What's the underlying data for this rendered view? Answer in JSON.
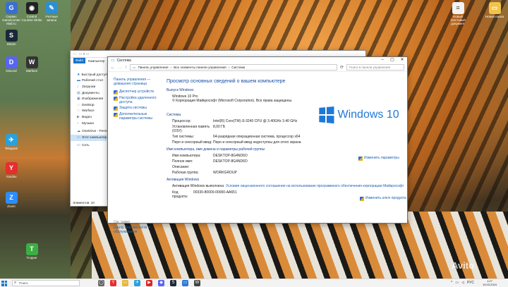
{
  "desktop": {
    "icons": [
      {
        "label": "Сервис GameCenter Mail.ru",
        "glyph": "G",
        "color": "#3a6fd0"
      },
      {
        "label": "Control Counter-Strike",
        "glyph": "◉",
        "color": "#222"
      },
      {
        "label": "Учетные записи",
        "glyph": "✎",
        "color": "#2c8fd6"
      },
      {
        "label": "Новый текстовый документ",
        "glyph": "≡",
        "color": "#f2f2f2"
      },
      {
        "label": "Новая папка",
        "glyph": "▭",
        "color": "#f1c34a"
      },
      {
        "label": "Steam",
        "glyph": "S",
        "color": "#1b2838"
      },
      {
        "label": "Discord",
        "glyph": "D",
        "color": "#5865f2"
      },
      {
        "label": "Warface",
        "glyph": "W",
        "color": "#333"
      },
      {
        "label": "Telegram",
        "glyph": "✈",
        "color": "#2aa1da"
      },
      {
        "label": "Yandex",
        "glyph": "Y",
        "color": "#e62e2e"
      },
      {
        "label": "Zoom",
        "glyph": "Z",
        "color": "#2d8cff"
      },
      {
        "label": "Tropper",
        "glyph": "T",
        "color": "#3cae45"
      }
    ],
    "watermark": "Avito"
  },
  "explorer": {
    "ribbon": [
      "Файл",
      "Компьютер",
      "Вид"
    ],
    "nav": [
      {
        "label": "Быстрый доступ",
        "icon": "★",
        "color": "#1e78d7"
      },
      {
        "label": "Рабочий стол",
        "icon": "▬",
        "color": "#2b7bd4"
      },
      {
        "label": "Загрузки",
        "icon": "↓",
        "color": "#2b7bd4"
      },
      {
        "label": "Документы",
        "icon": "▤",
        "color": "#6c8bb3"
      },
      {
        "label": "Изображения",
        "icon": "▣",
        "color": "#6c8bb3"
      },
      {
        "label": "Desktop",
        "icon": "▭",
        "color": "#e8b73a"
      },
      {
        "label": "Warface",
        "icon": "▭",
        "color": "#e8b73a"
      },
      {
        "label": "Видео",
        "icon": "▶",
        "color": "#6c8bb3"
      },
      {
        "label": "Музыка",
        "icon": "♪",
        "color": "#6c8bb3"
      },
      {
        "label": "OneDrive - Personal",
        "icon": "☁",
        "color": "#1e78d7"
      },
      {
        "label": "Этот компьютер",
        "icon": "▭",
        "color": "#2b7bd4"
      },
      {
        "label": "Сеть",
        "icon": "▭",
        "color": "#2b7bd4"
      }
    ],
    "status": "Элементов: 10"
  },
  "system": {
    "title": "Система",
    "breadcrumb": [
      "Панель управления",
      "Все элементы панели управления",
      "Система"
    ],
    "search_placeholder": "Поиск в панели управления",
    "left": {
      "home": "Панель управления — домашняя страница",
      "links": [
        "Диспетчер устройств",
        "Настройка удаленного доступа",
        "Защита системы",
        "Дополнительные параметры системы"
      ],
      "see_also": "См. также",
      "bottom": "Центр безопасности и обслуживания"
    },
    "heading": "Просмотр основных сведений о вашем компьютере",
    "edition_title": "Выпуск Windows",
    "edition": "Windows 10 Pro",
    "copyright": "© Корпорация Майкрософт (Microsoft Corporation). Все права защищены.",
    "logo_text": "Windows 10",
    "system_title": "Система",
    "system_rows": [
      {
        "k": "Процессор:",
        "v": "Intel(R) Core(TM) i3-3240 CPU @ 3.40GHz   3.40 GHz"
      },
      {
        "k": "Установленная память (ОЗУ):",
        "v": "8,00 ГБ"
      },
      {
        "k": "Тип системы:",
        "v": "64-разрядная операционная система, процессор x64"
      },
      {
        "k": "Перо и сенсорный ввод:",
        "v": "Перо и сенсорный ввод недоступны для этого экрана"
      }
    ],
    "name_title": "Имя компьютера, имя домена и параметры рабочей группы",
    "name_rows": [
      {
        "k": "Имя компьютера:",
        "v": "DESKTOP-8G4ND6O"
      },
      {
        "k": "Полное имя:",
        "v": "DESKTOP-8G4ND6O"
      },
      {
        "k": "Описание:",
        "v": ""
      },
      {
        "k": "Рабочая группа:",
        "v": "WORKGROUP"
      }
    ],
    "change_params": "Изменить параметры",
    "activation_title": "Активация Windows",
    "activation_status": "Активация Windows выполнена",
    "activation_link": "Условия лицензионного соглашения на использование программного обеспечения корпорации Майкрософт",
    "product_code_label": "Код продукта:",
    "product_code": "00330-80000-00000-AA651",
    "change_key": "Изменить ключ продукта"
  },
  "taskbar": {
    "search_placeholder": "Поиск",
    "apps": [
      {
        "glyph": "◯",
        "color": "#666"
      },
      {
        "glyph": "Y",
        "color": "#e62e2e"
      },
      {
        "glyph": "▭",
        "color": "#e8b73a"
      },
      {
        "glyph": "✈",
        "color": "#2aa1da"
      },
      {
        "glyph": "▶",
        "color": "#e02424"
      },
      {
        "glyph": "◆",
        "color": "#5865f2"
      },
      {
        "glyph": "S",
        "color": "#1b2838"
      },
      {
        "glyph": "▭",
        "color": "#2b7bd4"
      },
      {
        "glyph": "W",
        "color": "#444"
      }
    ],
    "time": "1:27",
    "date": "19.03.2024"
  }
}
